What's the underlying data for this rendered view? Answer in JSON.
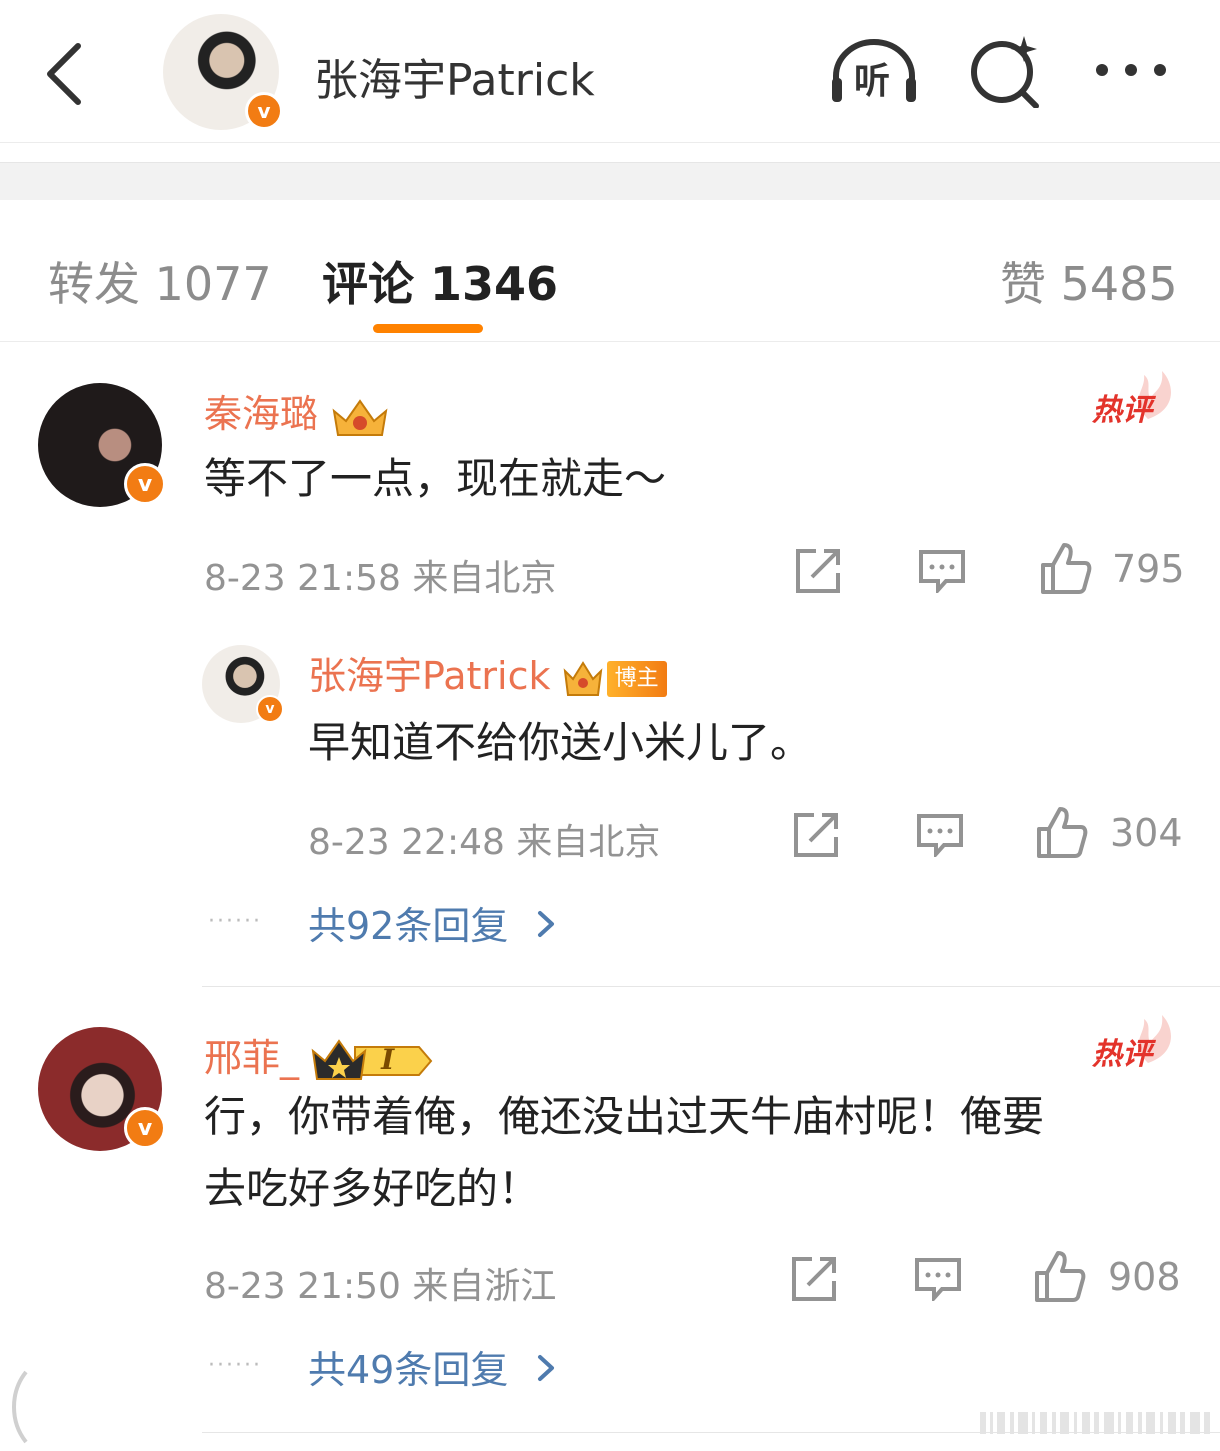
{
  "header": {
    "title": "张海宇Patrick",
    "listen_label": "听",
    "verified_mark": "v",
    "icons": [
      "back-icon",
      "listen-icon",
      "search-sparkle-icon",
      "more-icon"
    ]
  },
  "tabs": [
    {
      "label": "转发 1077"
    },
    {
      "label": "评论 1346"
    },
    {
      "label": "赞 5485"
    }
  ],
  "comments": [
    {
      "author": "秦海璐",
      "hot_label": "热评",
      "text": "等不了一点，现在就走～",
      "time_location": "8-23 21:58  来自北京",
      "likes": "795",
      "reply": {
        "author": "张海宇Patrick",
        "owner_tag": "博主",
        "text": "早知道不给你送小米儿了。",
        "time_location": "8-23 22:48  来自北京",
        "likes": "304"
      },
      "more_replies": "共92条回复"
    },
    {
      "author": "邢菲_",
      "level": "I",
      "hot_label": "热评",
      "text_line1": "行，你带着俺，俺还没出过天牛庙村呢！俺要",
      "text_line2": "去吃好多好吃的！",
      "time_location": "8-23 21:50  来自浙江",
      "likes": "908",
      "more_replies": "共49条回复"
    }
  ],
  "colors": {
    "accent": "#ff8200",
    "username": "#eb7350",
    "link": "#4f7bae",
    "hot": "#e3332b",
    "verified": "#f27c13"
  }
}
